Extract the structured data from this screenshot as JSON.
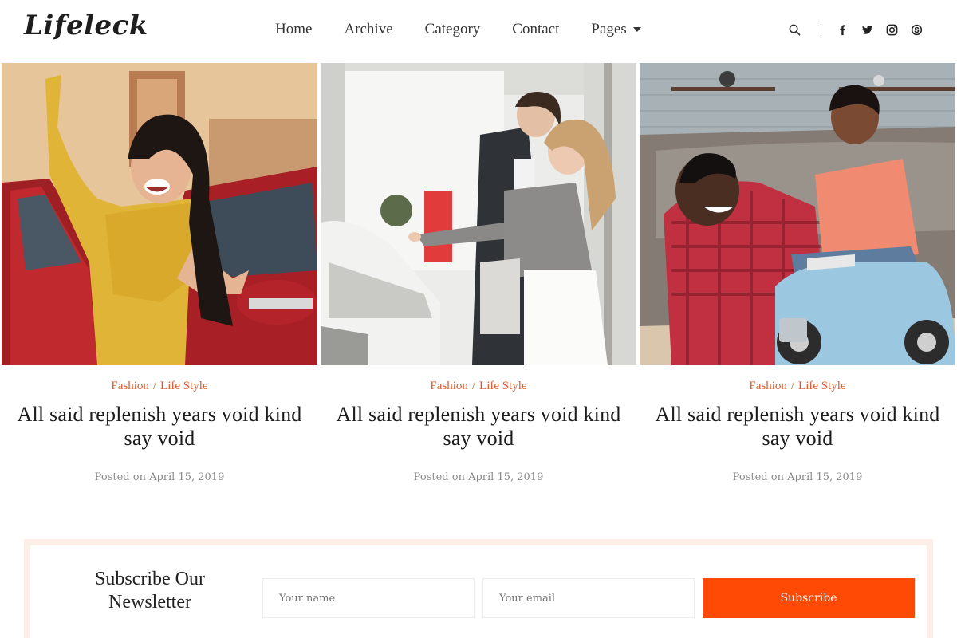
{
  "brand": {
    "logo": "Lifeleck"
  },
  "nav": {
    "items": [
      {
        "label": "Home"
      },
      {
        "label": "Archive"
      },
      {
        "label": "Category"
      },
      {
        "label": "Contact"
      },
      {
        "label": "Pages",
        "has_dropdown": true
      }
    ]
  },
  "header_tools": {
    "icons": [
      "search-icon",
      "facebook-icon",
      "twitter-icon",
      "instagram-icon",
      "skype-icon"
    ]
  },
  "posts": [
    {
      "category_1": "Fashion",
      "separator": "/",
      "category_2": "Life Style",
      "title": "All said replenish years void kind say void",
      "date": "Posted on April 15, 2019",
      "image": "woman-leaning-out-of-red-car"
    },
    {
      "category_1": "Fashion",
      "separator": "/",
      "category_2": "Life Style",
      "title": "All said replenish years void kind say void",
      "date": "Posted on April 15, 2019",
      "image": "couple-in-car-showroom"
    },
    {
      "category_1": "Fashion",
      "separator": "/",
      "category_2": "Life Style",
      "title": "All said replenish years void kind say void",
      "date": "Posted on April 15, 2019",
      "image": "father-and-son-with-toy-car"
    }
  ],
  "newsletter": {
    "title": "Subscribe Our Newsletter",
    "name_placeholder": "Your name",
    "email_placeholder": "Your email",
    "button_label": "Subscribe"
  },
  "colors": {
    "accent": "#ff4a06",
    "category": "#e4582a",
    "newsletter_border": "#fcefe8"
  }
}
